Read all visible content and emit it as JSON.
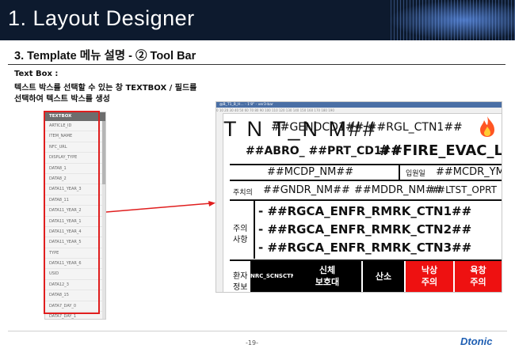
{
  "header": {
    "title": "1. Layout Designer"
  },
  "section": {
    "title": "3.  Template 메뉴 설명 - ② Tool Bar"
  },
  "description": {
    "title": "Text Box :",
    "line1": "텍스트 박스를 선택할 수 있는 창 TEXTBOX / 필드를",
    "line2": "선택하여 텍스트 박스를 생성"
  },
  "field_panel": {
    "header": "TEXTBOX",
    "items": [
      "ARTICLE_ID",
      "ITEM_NAME",
      "NFC_URL",
      "DISPLAY_TYPE",
      "DATA8_1",
      "DATA8_2",
      "DATA11_YEAR_3",
      "DATA8_11",
      "DATA11_YEAR_2",
      "DATA11_YEAR_1",
      "DATA11_YEAR_4",
      "DATA11_YEAR_5",
      "TYPE",
      "DATA11_YEAR_6",
      "USID",
      "DATA12_3",
      "DATA8_15",
      "DATA7_DAY_0",
      "DATA7_DAY_1"
    ]
  },
  "editor": {
    "titlebar": "@B_T1_B_H... - 1'8\" - ver3-bar",
    "ruler": "0   10   20   30   40   50   60   70   80   90   100   110   120   130   140   150   160   170   180   190",
    "canvas": {
      "big_title": "T N T_N M##",
      "overlay_top": "##GENDCD1## ##RGL_CTN1##",
      "row2_a": "##ABRO_ ##PRT_CD1##",
      "row2_b": "##FIRE_EVAC_L",
      "fire_icon": "flame-icon",
      "mcdp": "##MCDP_NM##",
      "admit_label": "입원일",
      "mcdr": "##MCDR_YMD",
      "doctor_label": "주치의",
      "gndr": "##GNDR_NM##",
      "mddr": "##MDDR_NM##",
      "ltst": "##LTST_OPRT",
      "notes_label_1": "주의",
      "notes_label_2": "사항",
      "notes": [
        "##RGCA_ENFR_RMRK_CTN1##",
        "##RGCA_ENFR_RMRK_CTN2##",
        "##RGCA_ENFR_RMRK_CTN3##"
      ],
      "patient_label_1": "환자",
      "patient_label_2": "정보",
      "cell_black_small": "NRC_SCNSCTN",
      "cell_body_1": "신체",
      "cell_body_2": "보호대",
      "cell_oxygen": "산소",
      "cell_fall_1": "낙상",
      "cell_fall_2": "주의",
      "cell_sore_1": "욕창",
      "cell_sore_2": "주의"
    }
  },
  "footer": {
    "page": "-19-",
    "logo": "Dtonic"
  },
  "colors": {
    "header_bg": "#0d1a2e",
    "highlight": "#e01e1e",
    "cell_red": "#ee1111",
    "logo": "#1f5fb3"
  }
}
